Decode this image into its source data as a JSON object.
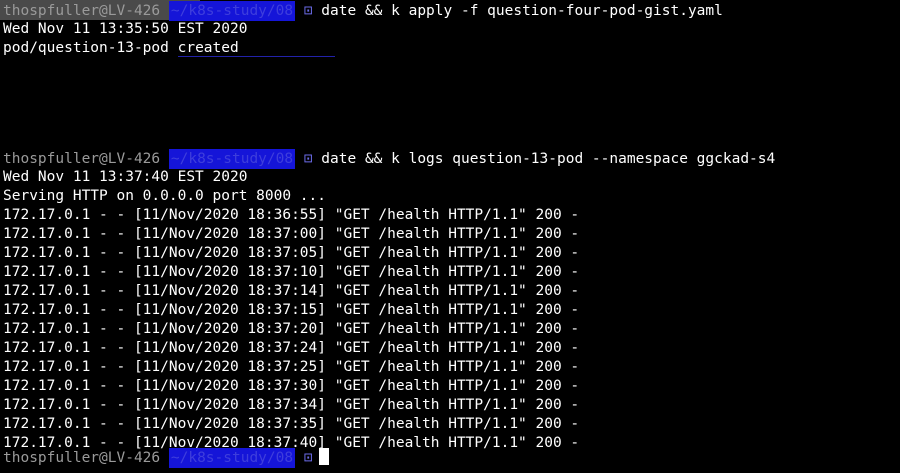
{
  "prompts": [
    {
      "user": "thospfuller@LV-426",
      "path": "~/k8s-study/08",
      "separator": "⊡",
      "command": "date && k apply -f question-four-pod-gist.yaml"
    },
    {
      "user": "thospfuller@LV-426",
      "path": "~/k8s-study/08",
      "separator": "⊡",
      "command": "date && k logs question-13-pod --namespace ggckad-s4"
    },
    {
      "user": "thospfuller@LV-426",
      "path": "~/k8s-study/08",
      "separator": "⊡",
      "command": ""
    }
  ],
  "output_block_1": {
    "date": "Wed Nov 11 13:35:50 EST 2020",
    "result_resource": "pod/question-13-pod",
    "result_status": "created"
  },
  "output_block_2": {
    "date": "Wed Nov 11 13:37:40 EST 2020",
    "serving": "Serving HTTP on 0.0.0.0 port 8000 ...",
    "log_lines": [
      "172.17.0.1 - - [11/Nov/2020 18:36:55] \"GET /health HTTP/1.1\" 200 -",
      "172.17.0.1 - - [11/Nov/2020 18:37:00] \"GET /health HTTP/1.1\" 200 -",
      "172.17.0.1 - - [11/Nov/2020 18:37:05] \"GET /health HTTP/1.1\" 200 -",
      "172.17.0.1 - - [11/Nov/2020 18:37:10] \"GET /health HTTP/1.1\" 200 -",
      "172.17.0.1 - - [11/Nov/2020 18:37:14] \"GET /health HTTP/1.1\" 200 -",
      "172.17.0.1 - - [11/Nov/2020 18:37:15] \"GET /health HTTP/1.1\" 200 -",
      "172.17.0.1 - - [11/Nov/2020 18:37:20] \"GET /health HTTP/1.1\" 200 -",
      "172.17.0.1 - - [11/Nov/2020 18:37:24] \"GET /health HTTP/1.1\" 200 -",
      "172.17.0.1 - - [11/Nov/2020 18:37:25] \"GET /health HTTP/1.1\" 200 -",
      "172.17.0.1 - - [11/Nov/2020 18:37:30] \"GET /health HTTP/1.1\" 200 -",
      "172.17.0.1 - - [11/Nov/2020 18:37:34] \"GET /health HTTP/1.1\" 200 -",
      "172.17.0.1 - - [11/Nov/2020 18:37:35] \"GET /health HTTP/1.1\" 200 -",
      "172.17.0.1 - - [11/Nov/2020 18:37:40] \"GET /health HTTP/1.1\" 200 -"
    ]
  }
}
